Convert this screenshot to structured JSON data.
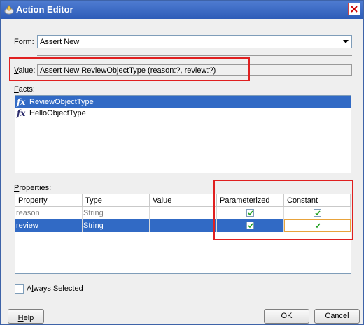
{
  "window": {
    "title": "Action Editor",
    "colors": {
      "titlebar": "#2d5cb8",
      "selection": "#316ac5",
      "annotation_red": "#e02020"
    }
  },
  "form": {
    "label_prefix": "F",
    "label_rest": "orm:",
    "selected": "Assert New"
  },
  "value": {
    "label_prefix": "V",
    "label_rest": "alue:",
    "text": "Assert New ReviewObjectType (reason:?, review:?)"
  },
  "facts": {
    "label_prefix": "F",
    "label_rest": "acts:",
    "items": [
      {
        "icon": "fx-icon",
        "label": "ReviewObjectType",
        "selected": true
      },
      {
        "icon": "fx-icon",
        "label": "HelloObjectType",
        "selected": false
      }
    ]
  },
  "properties": {
    "label_prefix": "P",
    "label_rest": "roperties:",
    "columns": [
      "Property",
      "Type",
      "Value",
      "Parameterized",
      "Constant"
    ],
    "rows": [
      {
        "property": "reason",
        "type": "String",
        "value": "",
        "parameterized": true,
        "constant": true,
        "selected": false
      },
      {
        "property": "review",
        "type": "String",
        "value": "",
        "parameterized": true,
        "constant": true,
        "selected": true
      }
    ]
  },
  "always_selected": {
    "label_a": "A",
    "label_l": "l",
    "label_rest": "ways Selected",
    "checked": false
  },
  "buttons": {
    "help_prefix": "H",
    "help_rest": "elp",
    "ok": "OK",
    "cancel": "Cancel"
  }
}
